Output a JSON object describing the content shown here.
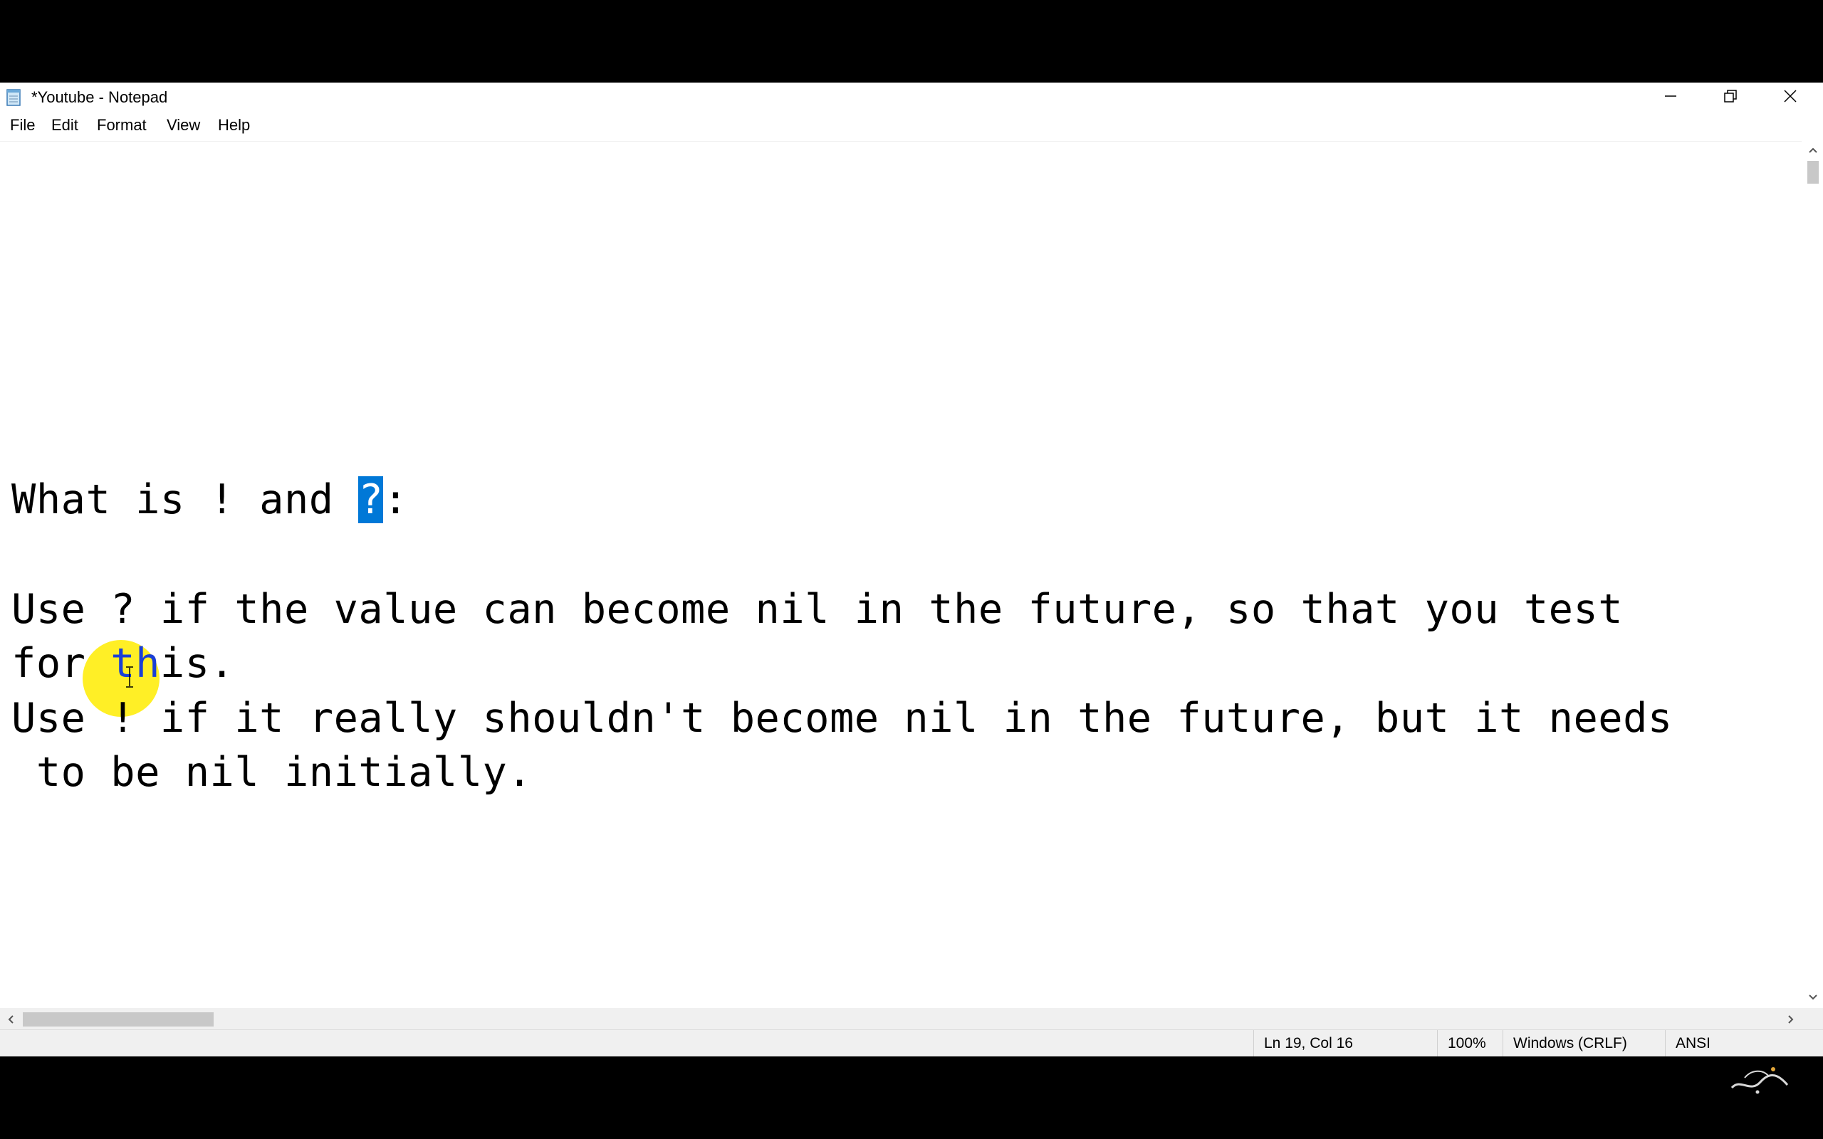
{
  "window": {
    "title": "*Youtube - Notepad"
  },
  "menu": {
    "items": [
      "File",
      "Edit",
      "Format",
      "View",
      "Help"
    ]
  },
  "document": {
    "line1_pre": "What is ! and ",
    "line1_sel": "?",
    "line1_post": ":",
    "line2": "Use ? if the value can become nil in the future, so that you test",
    "line3_pre": "for ",
    "line3_sel": "th",
    "line3_post": "is.",
    "line4": "Use ! if it really shouldn't become nil in the future, but it needs",
    "line5": " to be nil initially."
  },
  "status": {
    "position": "Ln 19, Col 16",
    "zoom": "100%",
    "line_ending": "Windows (CRLF)",
    "encoding": "ANSI"
  },
  "icons": {
    "app": "notepad-icon",
    "minimize": "minimize-icon",
    "maximize": "restore-icon",
    "close": "close-icon"
  },
  "colors": {
    "selection": "#0078d7",
    "cursor_highlight": "#ffec00"
  }
}
